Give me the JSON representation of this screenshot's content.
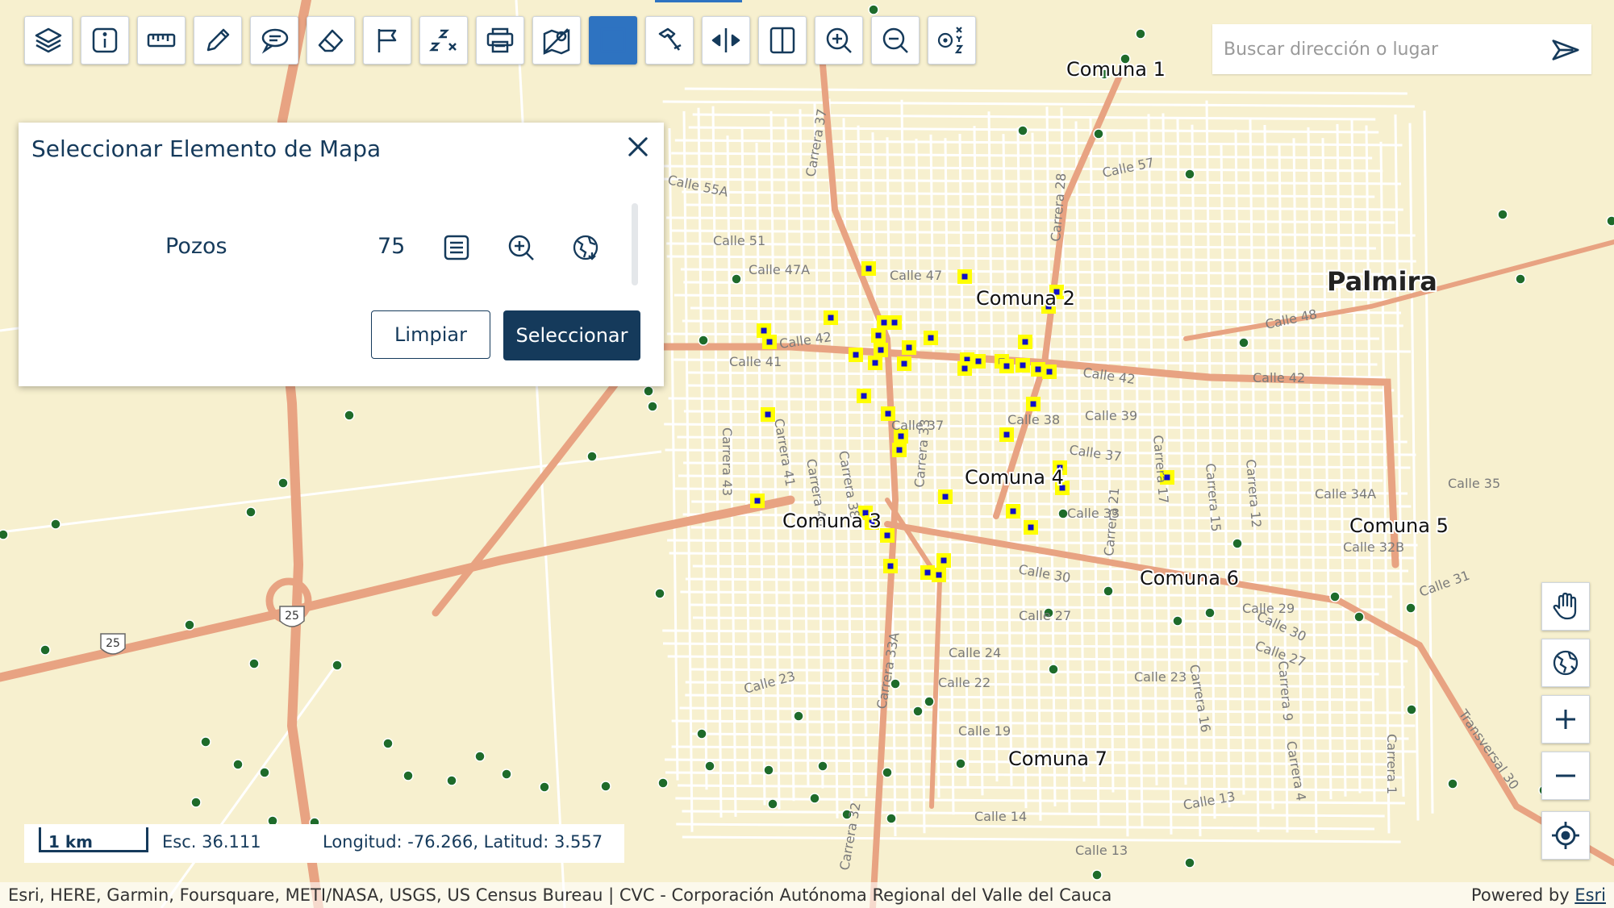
{
  "toolbar": {
    "buttons": [
      {
        "name": "layers",
        "icon": "layers-icon"
      },
      {
        "name": "info",
        "icon": "info-icon"
      },
      {
        "name": "measure",
        "icon": "ruler-icon"
      },
      {
        "name": "draw",
        "icon": "pencil-icon"
      },
      {
        "name": "annotate",
        "icon": "speech-bubble-icon"
      },
      {
        "name": "erase",
        "icon": "eraser-icon"
      },
      {
        "name": "flag",
        "icon": "flag-icon"
      },
      {
        "name": "coordinates",
        "icon": "zx-axes-icon"
      },
      {
        "name": "print",
        "icon": "printer-icon"
      },
      {
        "name": "location-off",
        "icon": "location-off-icon"
      },
      {
        "name": "select",
        "icon": "select-icon"
      },
      {
        "name": "hammer",
        "icon": "hammer-icon"
      },
      {
        "name": "swipe",
        "icon": "swipe-arrows-icon"
      },
      {
        "name": "compare",
        "icon": "split-panel-icon"
      },
      {
        "name": "zoom-in",
        "icon": "zoom-in-icon"
      },
      {
        "name": "zoom-out",
        "icon": "zoom-out-icon"
      },
      {
        "name": "xyz",
        "icon": "xyz-icon"
      }
    ],
    "active_color": "#2e73c1"
  },
  "search": {
    "placeholder": "Buscar dirección o lugar"
  },
  "panel": {
    "title": "Seleccionar Elemento de Mapa",
    "layer_name": "Pozos",
    "layer_count": "75",
    "clear_label": "Limpiar",
    "select_label": "Seleccionar"
  },
  "map": {
    "city_label": "Palmira",
    "highway_shield": "25",
    "comuna_labels": [
      "Comuna 1",
      "Comuna 2",
      "Comuna 3",
      "Comuna 4",
      "Comuna 5",
      "Comuna 6",
      "Comuna 7"
    ],
    "street_labels": [
      "Calle 55A",
      "Calle 57",
      "Calle 51",
      "Calle 47A",
      "Calle 47",
      "Calle 48",
      "Calle 42",
      "Calle 41",
      "Calle 42",
      "Calle 42",
      "Calle 38",
      "Calle 39",
      "Calle 37",
      "Calle 37",
      "Calle 35",
      "Calle 34A",
      "Calle 33",
      "Calle 32B",
      "Calle 30",
      "Calle 30",
      "Calle 29",
      "Calle 27",
      "Calle 27",
      "Calle 24",
      "Calle 23",
      "Calle 23",
      "Calle 22",
      "Calle 19",
      "Calle 14",
      "Calle 13",
      "Calle 13",
      "Calle 31",
      "Carrera 37",
      "Carrera 28",
      "Carrera 43",
      "Carrera 41",
      "Carrera 40",
      "Carrera 38",
      "Carrera 33",
      "Carrera 33A",
      "Carrera 32",
      "Carrera 21",
      "Carrera 17",
      "Carrera 15",
      "Carrera 12",
      "Carrera 9",
      "Carrera 16",
      "Carrera 4",
      "Carrera 1",
      "Transversal 30"
    ],
    "colors": {
      "background": "#f7f0cf",
      "main_road": "#e8a382",
      "street": "#ffffff",
      "selected_fill": "#ffff00",
      "selected_core": "#1010c8",
      "well_point": "#1e6b2a"
    }
  },
  "side_controls": [
    {
      "name": "pan",
      "icon": "hand-icon"
    },
    {
      "name": "basemap",
      "icon": "globe-icon"
    },
    {
      "name": "zoom-in",
      "icon": "plus-icon"
    },
    {
      "name": "zoom-out",
      "icon": "minus-icon"
    },
    {
      "name": "locate",
      "icon": "crosshair-icon"
    }
  ],
  "scale": {
    "label": "1 km",
    "ratio": "Esc. 36.111",
    "coords": "Longitud: -76.266, Latitud: 3.557"
  },
  "attribution": {
    "text": "Esri, HERE, Garmin, Foursquare, METI/NASA, USGS, US Census Bureau | CVC - Corporación Autónoma Regional del Valle del Cauca",
    "powered_prefix": "Powered by",
    "powered_link": "Esri"
  }
}
